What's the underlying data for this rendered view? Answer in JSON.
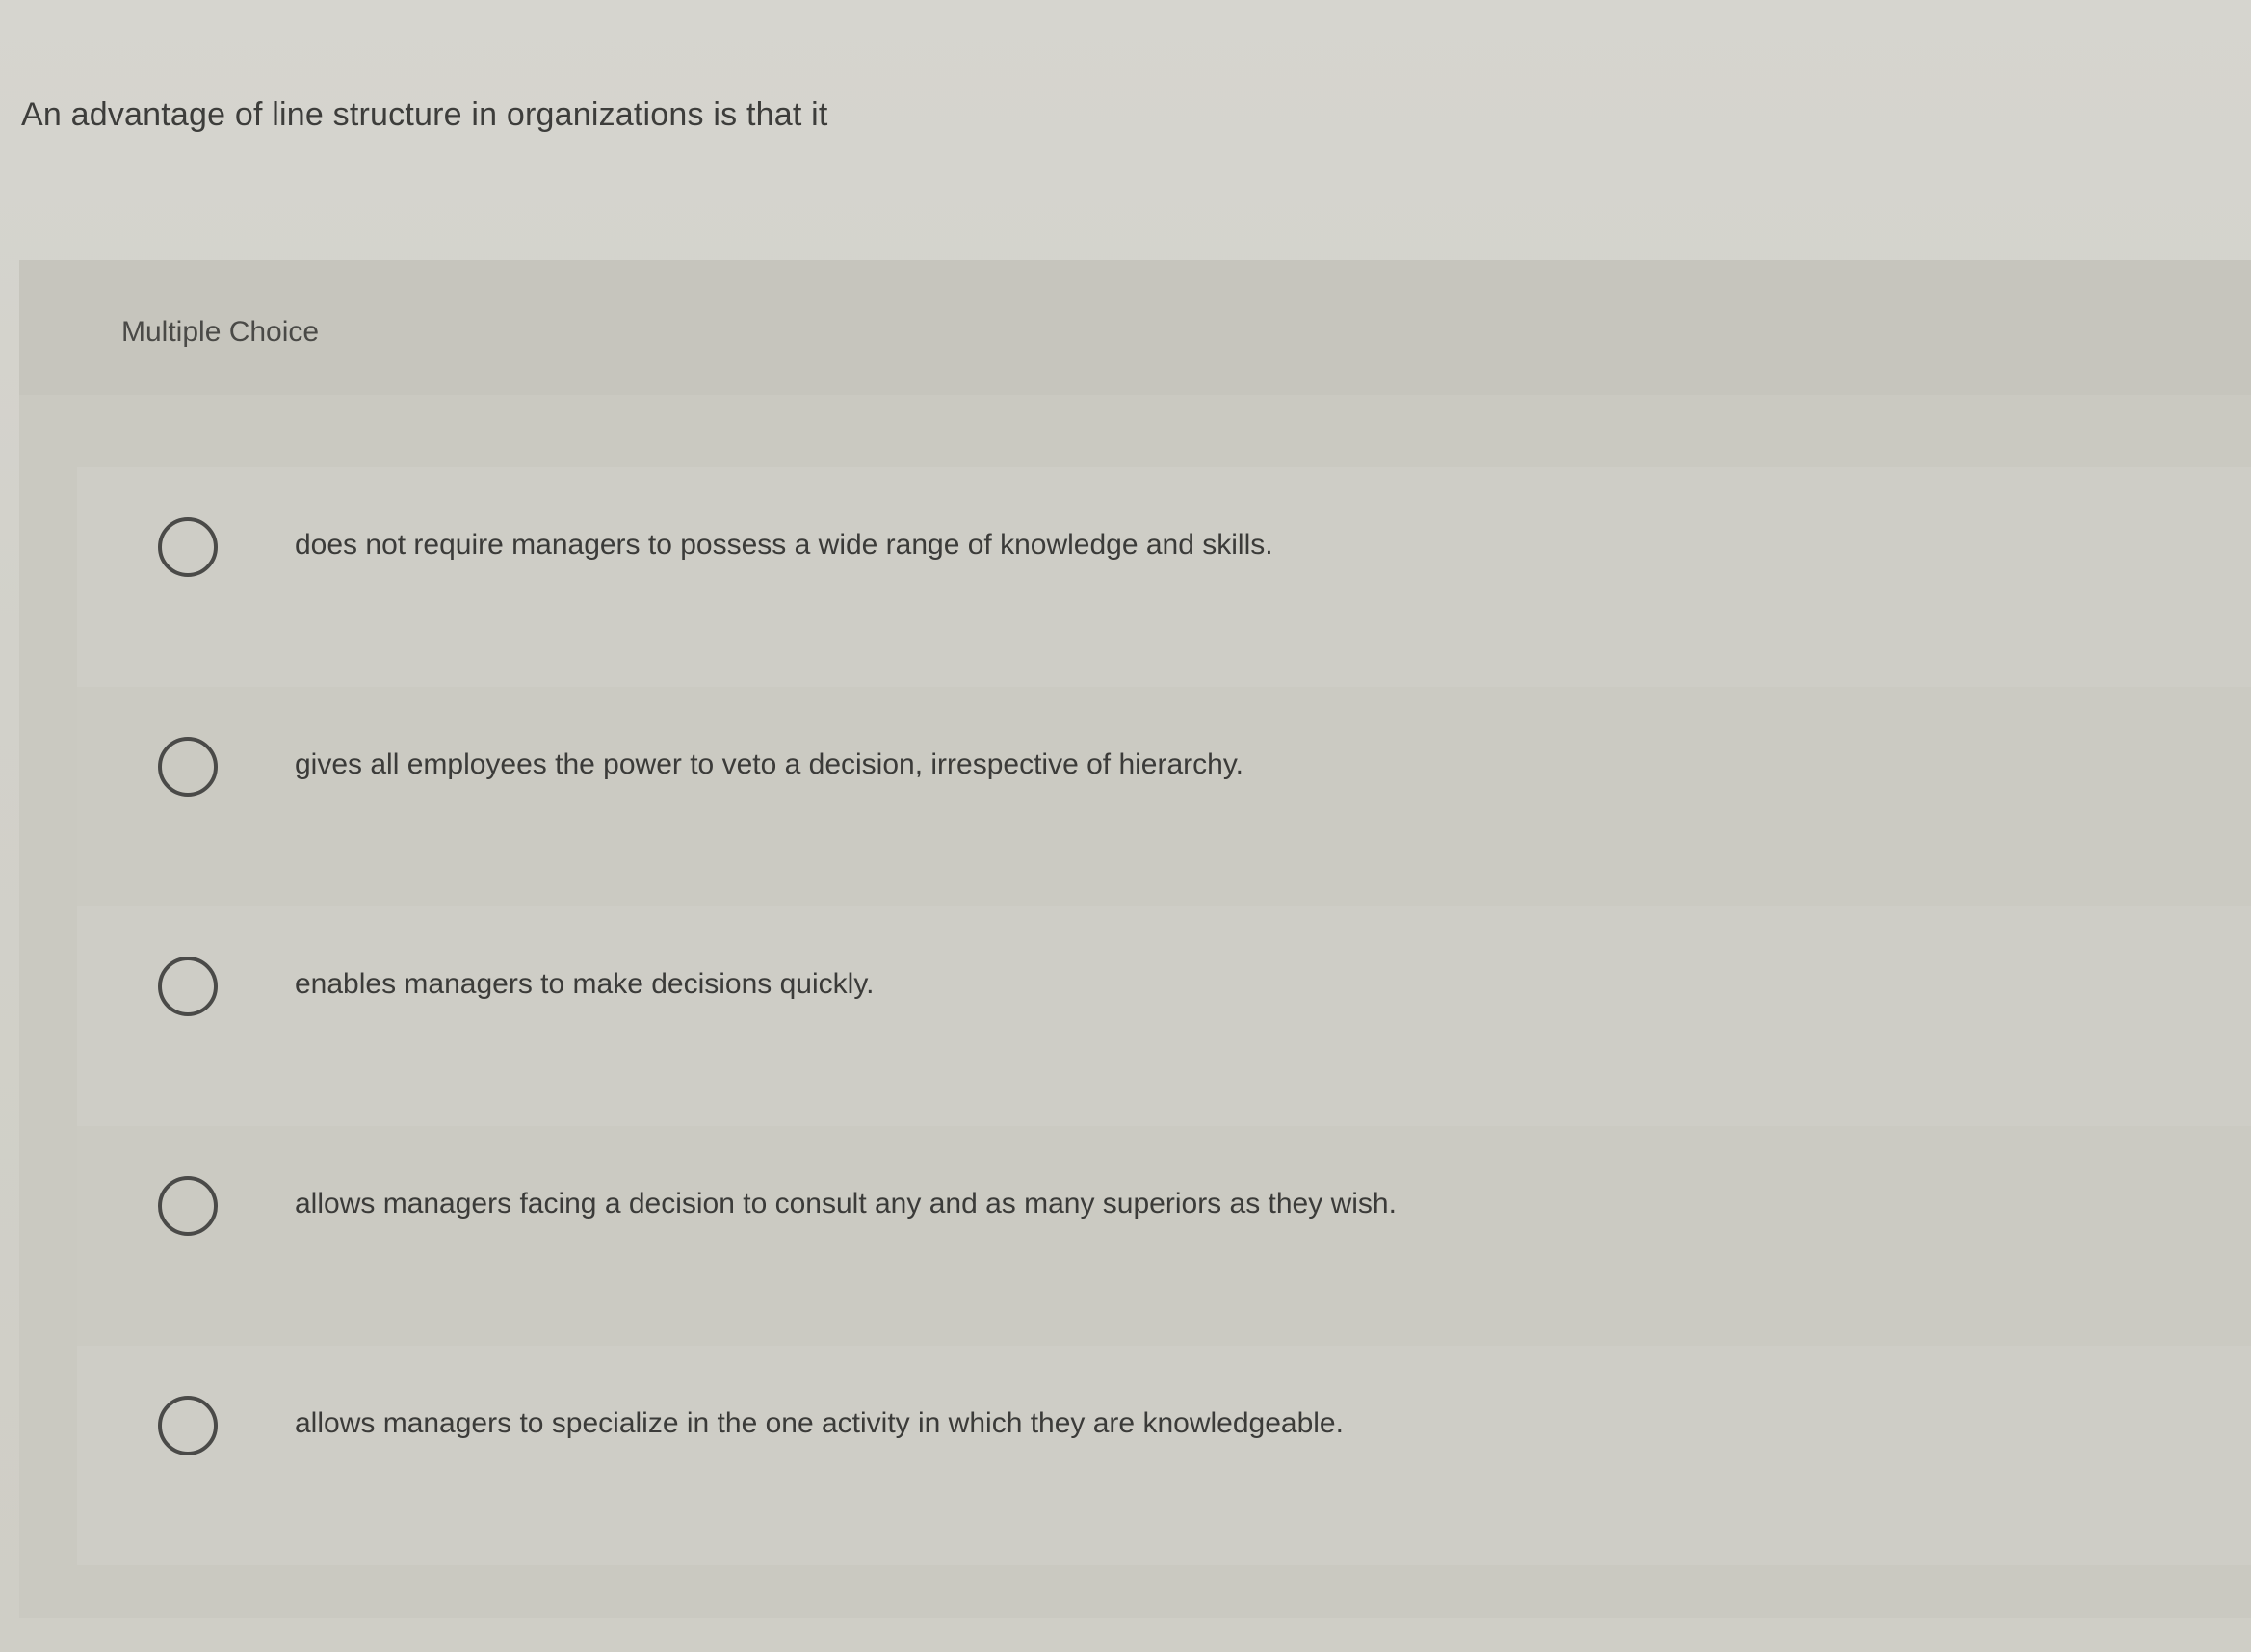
{
  "question": {
    "text": "An advantage of line structure in organizations is that it"
  },
  "panel": {
    "label": "Multiple Choice"
  },
  "options": [
    {
      "text": "does not require managers to possess a wide range of knowledge and skills."
    },
    {
      "text": "gives all employees the power to veto a decision, irrespective of hierarchy."
    },
    {
      "text": "enables managers to make decisions quickly."
    },
    {
      "text": "allows managers facing a decision to consult any and as many superiors as they wish."
    },
    {
      "text": "allows managers to specialize in the one activity in which they are knowledgeable."
    }
  ]
}
